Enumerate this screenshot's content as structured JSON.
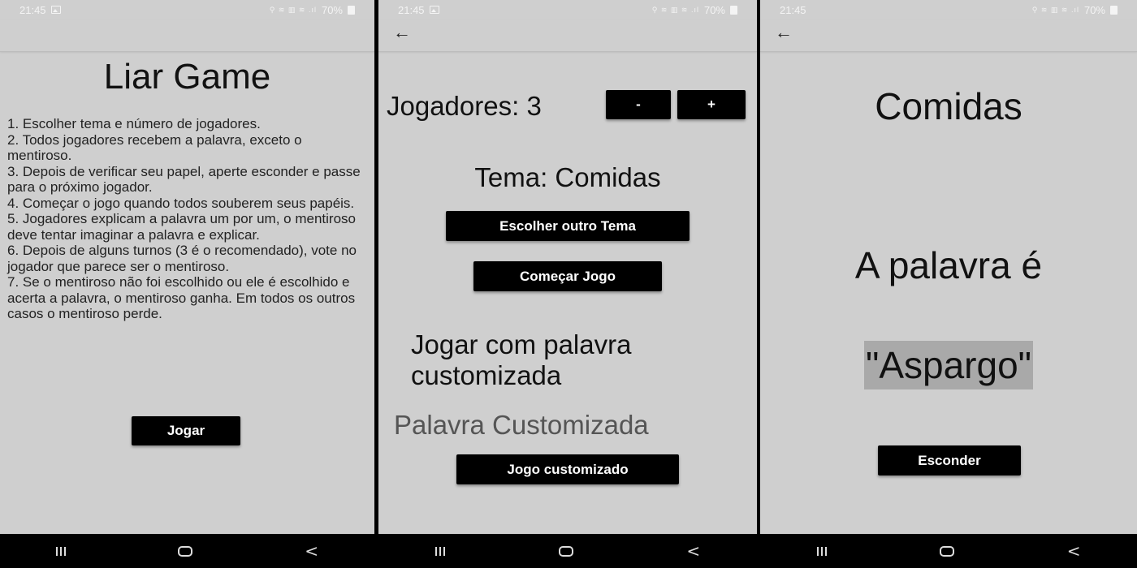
{
  "status": {
    "time": "21:45",
    "icons": "⚲ ≋ ▥ ≋ .ıl",
    "battery": "70%"
  },
  "screen1": {
    "title": "Liar Game",
    "rules": [
      "1. Escolher tema e número de jogadores.",
      "2. Todos jogadores recebem a palavra, exceto o mentiroso.",
      "3. Depois de verificar seu papel, aperte esconder e passe para o próximo jogador.",
      "4. Começar o jogo quando todos souberem seus papéis.",
      "5. Jogadores explicam a palavra um por um, o mentiroso deve tentar imaginar a palavra e explicar.",
      "6. Depois de alguns turnos (3 é o recomendado), vote no jogador que parece ser o mentiroso.",
      "7. Se o mentiroso não foi escolhido ou ele é escolhido e acerta a palavra, o mentiroso ganha. Em todos os outros casos o mentiroso perde."
    ],
    "play_label": "Jogar"
  },
  "screen2": {
    "players_label": "Jogadores: 3",
    "minus_label": "-",
    "plus_label": "+",
    "theme_label": "Tema: Comidas",
    "choose_theme_label": "Escolher outro Tema",
    "start_label": "Começar Jogo",
    "custom_heading": "Jogar com palavra customizada",
    "custom_placeholder": "Palavra Customizada",
    "custom_game_label": "Jogo customizado"
  },
  "screen3": {
    "theme": "Comidas",
    "word_intro": "A palavra é",
    "word": "\"Aspargo\"",
    "hide_label": "Esconder"
  },
  "nav": {
    "back": "<"
  },
  "colors": {
    "screen_bg": "#cfcfcf",
    "button_bg": "#000000",
    "word_highlight": "#a9a9a9"
  }
}
